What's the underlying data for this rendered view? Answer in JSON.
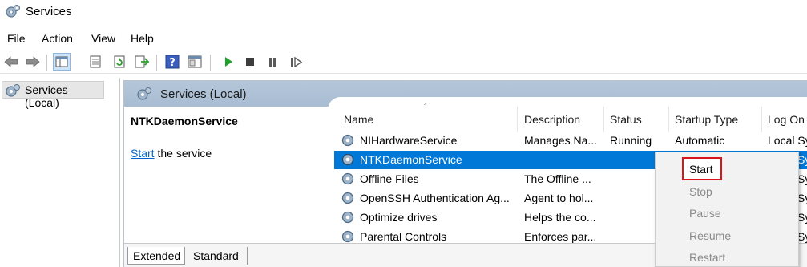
{
  "window": {
    "title": "Services"
  },
  "menu": [
    "File",
    "Action",
    "View",
    "Help"
  ],
  "toolbar": {
    "icons": [
      "back-icon",
      "forward-icon",
      "show-hide-tree-icon",
      "properties-icon",
      "refresh-icon",
      "export-list-icon",
      "help-icon",
      "console-view-icon",
      "play-icon",
      "stop-icon",
      "pause-icon",
      "resume-icon"
    ]
  },
  "tree": {
    "root_label": "Services (Local)"
  },
  "panel": {
    "header": "Services (Local)"
  },
  "extended": {
    "service_name": "NTKDaemonService",
    "start_link": "Start",
    "start_suffix": " the service"
  },
  "columns": [
    "Name",
    "Description",
    "Status",
    "Startup Type",
    "Log On"
  ],
  "rows": [
    {
      "name": "NIHardwareService",
      "description": "Manages Na...",
      "status": "Running",
      "startup": "Automatic",
      "logon": "Local Sy"
    },
    {
      "name": "NTKDaemonService",
      "description": "",
      "status": "",
      "startup": "",
      "logon": "Sy"
    },
    {
      "name": "Offline Files",
      "description": "The Offline ...",
      "status": "",
      "startup": "",
      "logon": "Sy"
    },
    {
      "name": "OpenSSH Authentication Ag...",
      "description": "Agent to hol...",
      "status": "",
      "startup": "",
      "logon": "Sy"
    },
    {
      "name": "Optimize drives",
      "description": "Helps the co...",
      "status": "",
      "startup": "",
      "logon": "Sy"
    },
    {
      "name": "Parental Controls",
      "description": "Enforces par...",
      "status": "",
      "startup": "",
      "logon": "Sy"
    }
  ],
  "tabs": [
    "Extended",
    "Standard"
  ],
  "context_menu": {
    "items": [
      {
        "label": "Start",
        "enabled": true
      },
      {
        "label": "Stop",
        "enabled": false
      },
      {
        "label": "Pause",
        "enabled": false
      },
      {
        "label": "Resume",
        "enabled": false
      },
      {
        "label": "Restart",
        "enabled": false
      }
    ]
  },
  "colors": {
    "selection": "#0078d7",
    "header_bg": "#b0c3d8",
    "highlight_box": "#d9141b",
    "link": "#0066cc"
  }
}
